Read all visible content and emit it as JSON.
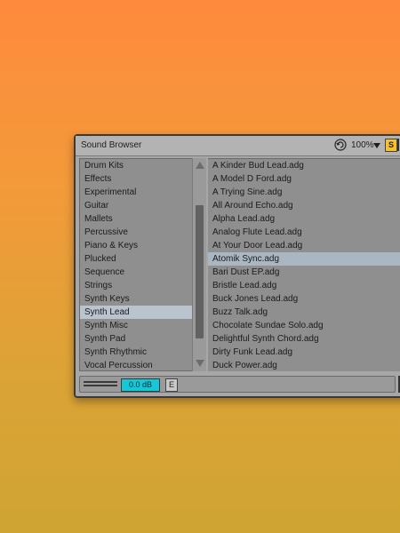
{
  "window": {
    "title": "Sound Browser",
    "zoom": "100%",
    "solo_label": "S"
  },
  "categories": [
    "Drum Kits",
    "Effects",
    "Experimental",
    "Guitar",
    "Mallets",
    "Percussive",
    "Piano & Keys",
    "Plucked",
    "Sequence",
    "Strings",
    "Synth Keys",
    "Synth Lead",
    "Synth Misc",
    "Synth Pad",
    "Synth Rhythmic",
    "Vocal Percussion"
  ],
  "selected_category_index": 11,
  "files": [
    "A Kinder Bud Lead.adg",
    "A Model D Ford.adg",
    "A Trying Sine.adg",
    "All Around Echo.adg",
    "Alpha Lead.adg",
    "Analog Flute Lead.adg",
    "At Your Door Lead.adg",
    "Atomik Sync.adg",
    "Bari Dust EP.adg",
    "Bristle Lead.adg",
    "Buck Jones Lead.adg",
    "Buzz Talk.adg",
    "Chocolate Sundae Solo.adg",
    "Delightful Synth Chord.adg",
    "Dirty Funk Lead.adg",
    "Duck Power.adg"
  ],
  "selected_file_index": 7,
  "bottom": {
    "gain": "0.0 dB",
    "e_label": "E"
  },
  "colors": {
    "gain_field": "#15c8d8",
    "solo_button": "#f6c12c",
    "selection": "#b9c4cf"
  },
  "icons": {
    "refresh": "refresh-icon",
    "zoom_dropdown": "chevron-down-icon",
    "scroll_up": "arrow-up-icon",
    "scroll_down": "arrow-down-icon"
  }
}
